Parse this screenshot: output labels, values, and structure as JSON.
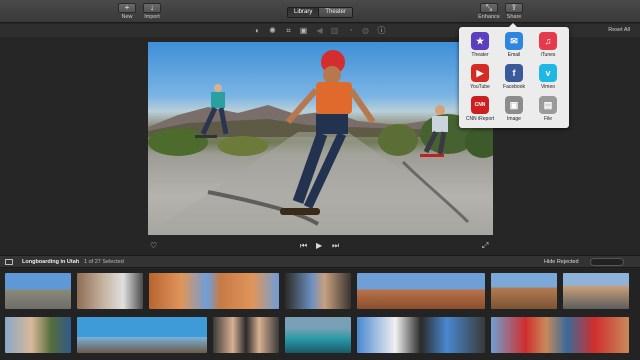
{
  "toolbar": {
    "new_label": "New",
    "import_label": "Import",
    "library_tab": "Library",
    "theater_tab": "Theater",
    "enhance_label": "Enhance",
    "share_label": "Share",
    "new_icon": "+",
    "import_icon": "↓",
    "enhance_icon": "⤡",
    "share_icon": "⇪"
  },
  "adjustments": {
    "reset_label": "Reset All"
  },
  "share_menu": {
    "items": [
      {
        "label": "Theater",
        "icon": "★",
        "color": "#5b3fbf"
      },
      {
        "label": "Email",
        "icon": "✉",
        "color": "#2e86e0"
      },
      {
        "label": "iTunes",
        "icon": "♫",
        "color": "#e43a4b"
      },
      {
        "label": "YouTube",
        "icon": "▶",
        "color": "#d62b23"
      },
      {
        "label": "Facebook",
        "icon": "f",
        "color": "#3b5a9a"
      },
      {
        "label": "Vimeo",
        "icon": "v",
        "color": "#1fb7e4"
      },
      {
        "label": "CNN iReport",
        "icon": "CNN",
        "color": "#cc1f1f"
      },
      {
        "label": "Image",
        "icon": "▣",
        "color": "#8c8c8c"
      },
      {
        "label": "File",
        "icon": "▤",
        "color": "#9a9a9a"
      }
    ]
  },
  "library": {
    "event_title": "Longboarding in Utah",
    "selection_status": "1 of 27 Selected",
    "filter_label": "Hide Rejected"
  }
}
